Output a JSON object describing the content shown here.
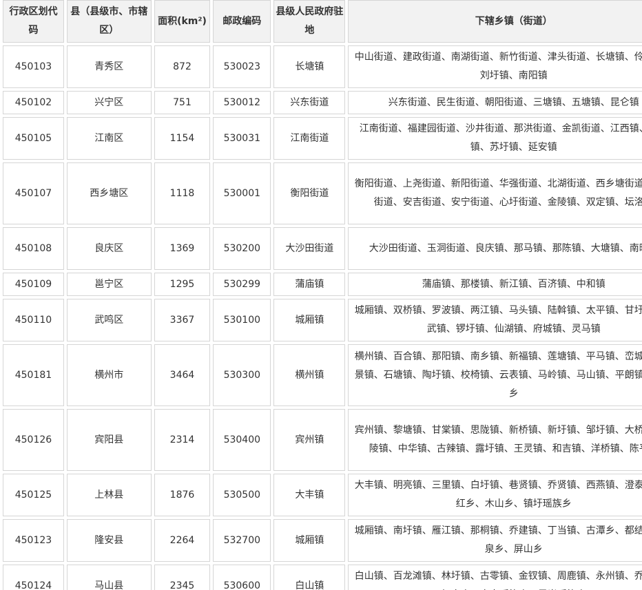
{
  "table": {
    "headers": [
      "行政区划代码",
      "县（县级市、市辖区）",
      "面积(km²)",
      "邮政编码",
      "县级人民政府驻地",
      "下辖乡镇（街道）"
    ],
    "rows": [
      [
        "450103",
        "青秀区",
        "872",
        "530023",
        "长塘镇",
        "中山街道、建政街道、南湖街道、新竹街道、津头街道、长塘镇、伶俐镇、刘圩镇、南阳镇"
      ],
      [
        "450102",
        "兴宁区",
        "751",
        "530012",
        "兴东街道",
        "兴东街道、民生街道、朝阳街道、三塘镇、五塘镇、昆仑镇"
      ],
      [
        "450105",
        "江南区",
        "1154",
        "530031",
        "江南街道",
        "江南街道、福建园街道、沙井街道、那洪街道、金凯街道、江西镇、吴圩镇、苏圩镇、延安镇"
      ],
      [
        "450107",
        "西乡塘区",
        "1118",
        "530001",
        "衡阳街道",
        "衡阳街道、上尧街道、新阳街道、华强街道、北湖街道、西乡塘街道、石埠街道、安吉街道、安宁街道、心圩街道、金陵镇、双定镇、坛洛镇"
      ],
      [
        "450108",
        "良庆区",
        "1369",
        "530200",
        "大沙田街道",
        "大沙田街道、玉洞街道、良庆镇、那马镇、那陈镇、大塘镇、南晓镇"
      ],
      [
        "450109",
        "邕宁区",
        "1295",
        "530299",
        "蒲庙镇",
        "蒲庙镇、那楼镇、新江镇、百济镇、中和镇"
      ],
      [
        "450110",
        "武鸣区",
        "3367",
        "530100",
        "城厢镇",
        "城厢镇、双桥镇、罗波镇、两江镇、马头镇、陆斡镇、太平镇、甘圩镇、宁武镇、锣圩镇、仙湖镇、府城镇、灵马镇"
      ],
      [
        "450181",
        "横州市",
        "3464",
        "530300",
        "横州镇",
        "横州镇、百合镇、那阳镇、南乡镇、新福镇、莲塘镇、平马镇、峦城镇、六景镇、石塘镇、陶圩镇、校椅镇、云表镇、马岭镇、马山镇、平朗镇、镇龙乡"
      ],
      [
        "450126",
        "宾阳县",
        "2314",
        "530400",
        "宾州镇",
        "宾州镇、黎塘镇、甘棠镇、思陇镇、新桥镇、新圩镇、邹圩镇、大桥镇、武陵镇、中华镇、古辣镇、露圩镇、王灵镇、和吉镇、洋桥镇、陈平镇"
      ],
      [
        "450125",
        "上林县",
        "1876",
        "530500",
        "大丰镇",
        "大丰镇、明亮镇、三里镇、白圩镇、巷贤镇、乔贤镇、西燕镇、澄泰乡、塘红乡、木山乡、镇圩瑶族乡"
      ],
      [
        "450123",
        "隆安县",
        "2264",
        "532700",
        "城厢镇",
        "城厢镇、南圩镇、雁江镇、那桐镇、乔建镇、丁当镇、古潭乡、都结乡、布泉乡、屏山乡"
      ],
      [
        "450124",
        "马山县",
        "2345",
        "530600",
        "白山镇",
        "白山镇、百龙滩镇、林圩镇、古零镇、金钗镇、周鹿镇、永州镇、乔利乡、加方乡、古寨瑶族乡、里当瑶族乡"
      ]
    ]
  }
}
